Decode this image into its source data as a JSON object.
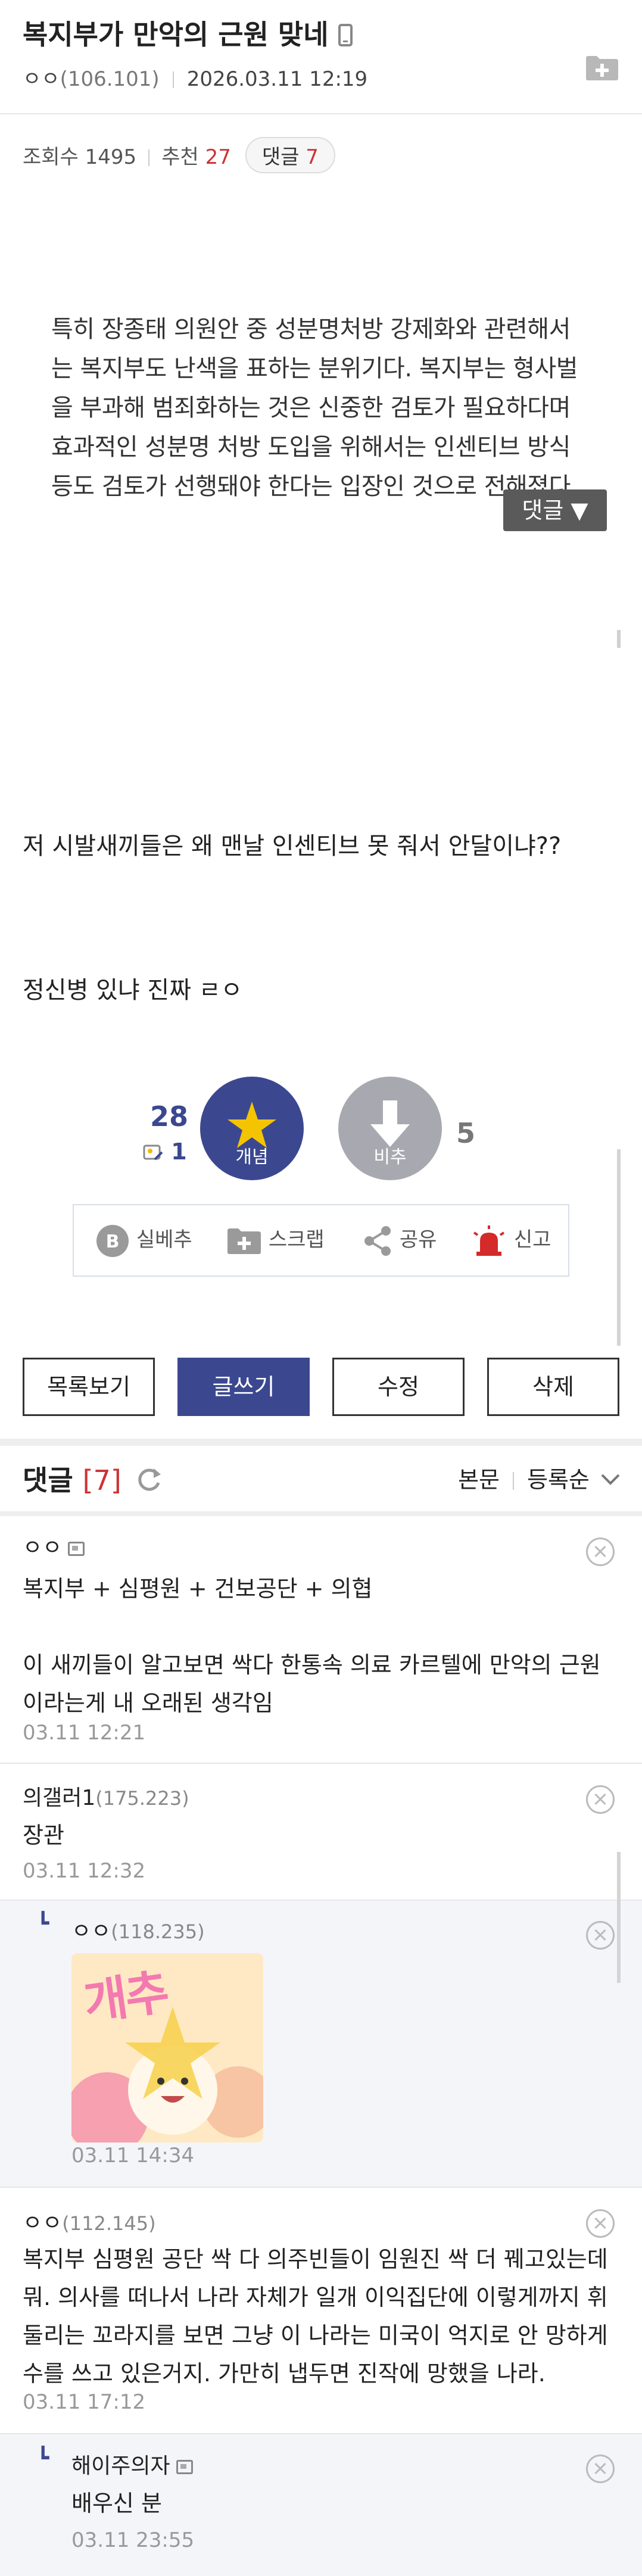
{
  "post": {
    "title": "복지부가 만악의 근원 맞네",
    "author": "ㅇㅇ",
    "author_ip": "(106.101)",
    "datetime": "2026.03.11 12:19",
    "views_label": "조회수 1495",
    "recommend_label": "추천",
    "recommend_count": "27",
    "comment_pill_label": "댓글",
    "comment_pill_count": "7",
    "body_quote": "특히 장종태 의원안 중 성분명처방 강제화와 관련해서는 복지부도 난색을 표하는 분위기다. 복지부는 형사벌을 부과해 범죄화하는 것은 신중한 검토가 필요하다며 효과적인 성분명 처방 도입을 위해서는 인센티브 방식 등도 검토가 선행돼야 한다는 입장인 것으로 전해졌다.",
    "float_comment_btn": "댓글 ▼",
    "line_a": "저 시발새끼들은 왜 맨날 인센티브 못 줘서 안달이냐??",
    "line_b": "정신병 있냐 진짜 ㄹㅇ"
  },
  "votes": {
    "up_count": "28",
    "up_sub_count": "1",
    "up_label": "개념",
    "down_label": "비추",
    "down_count": "5"
  },
  "share_bar": {
    "best_label": "실베추",
    "scrap_label": "스크랩",
    "share_label": "공유",
    "report_label": "신고"
  },
  "actions": {
    "list": "목록보기",
    "write": "글쓰기",
    "edit": "수정",
    "delete": "삭제"
  },
  "comments_header": {
    "title": "댓글",
    "count": "[7]",
    "sort_body": "본문",
    "sort_order": "등록순"
  },
  "comments": [
    {
      "name": "ㅇㅇ",
      "ip": "",
      "text": "복지부 + 심평원 + 건보공단 + 의협\n\n이 새끼들이 알고보면 싹다 한통속 의료 카르텔에 만악의 근원이라는게 내 오래된 생각임",
      "date": "03.11 12:21"
    },
    {
      "name": "의갤러1",
      "ip": "(175.223)",
      "text": "장관",
      "date": "03.11 12:32"
    },
    {
      "name": "ㅇㅇ",
      "ip": "(118.235)",
      "text": "",
      "date": "03.11 14:34",
      "sticker_text": "개추"
    },
    {
      "name": "ㅇㅇ",
      "ip": "(112.145)",
      "text": "복지부 심평원 공단 싹 다 의주빈들이 임원진 싹 더 꿰고있는데 뭐. 의사를 떠나서 나라 자체가 일개 이익집단에 이렇게까지 휘둘리는 꼬라지를 보면 그냥 이 나라는 미국이 억지로 안 망하게 수를 쓰고 있은거지. 가만히 냅두면 진작에 망했을 나라.",
      "date": "03.11 17:12"
    },
    {
      "name": "해이주의자",
      "ip": "",
      "text": "배우신 분",
      "date": "03.11 23:55"
    }
  ]
}
